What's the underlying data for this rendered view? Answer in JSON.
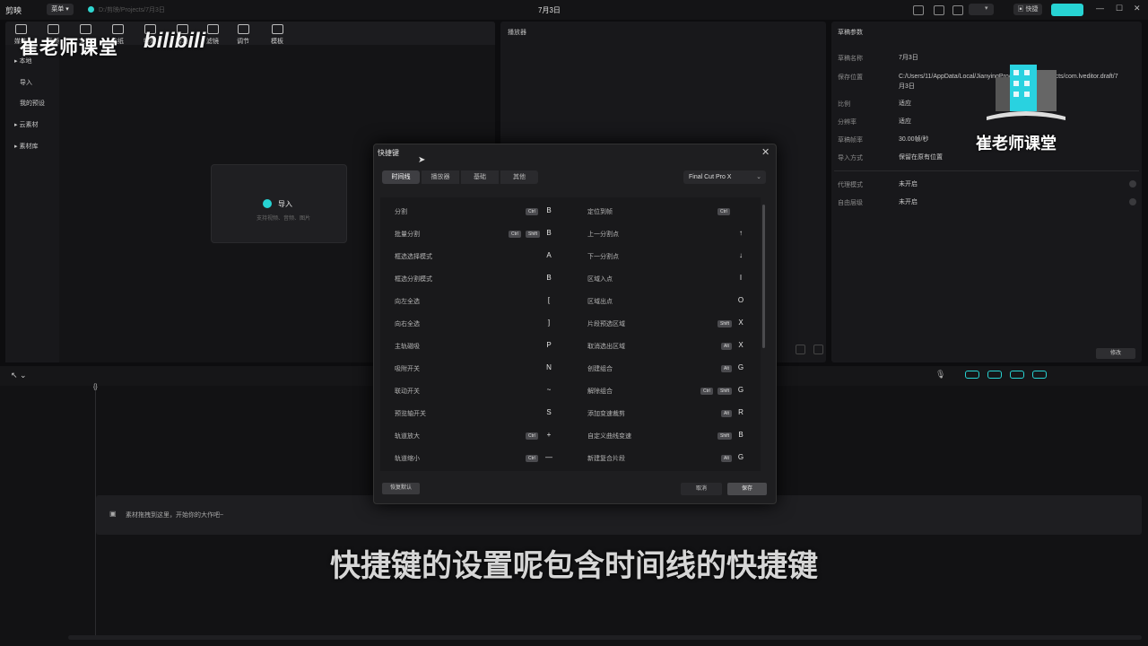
{
  "titlebar": {
    "app_name": "剪映",
    "menu_label": "菜单 ▾",
    "project_path": "D:/剪映/Projects/7月3日",
    "title": "7月3日",
    "pill_label": "▾",
    "pill2_label": "▣ 快捷",
    "window_controls": [
      "—",
      "☐",
      "✕"
    ]
  },
  "media": {
    "tools": [
      {
        "label": "媒体",
        "icon": "media-icon"
      },
      {
        "label": "音频",
        "icon": "audio-icon"
      },
      {
        "label": "文本",
        "icon": "text-icon"
      },
      {
        "label": "贴纸",
        "icon": "sticker-icon"
      },
      {
        "label": "特效",
        "icon": "effects-icon"
      },
      {
        "label": "转场",
        "icon": "transition-icon"
      },
      {
        "label": "滤镜",
        "icon": "filter-icon"
      },
      {
        "label": "调节",
        "icon": "adjust-icon"
      },
      {
        "label": "模板",
        "icon": "template-icon"
      }
    ],
    "sidebar": [
      "▸ 本地",
      "导入",
      "我的预设",
      "▸ 云素材",
      "▸ 素材库"
    ],
    "import_label": "导入",
    "import_sub": "支持视频、音频、图片"
  },
  "player": {
    "title": "播放器"
  },
  "draft": {
    "title": "草稿参数",
    "rows": [
      {
        "key": "草稿名称",
        "value": "7月3日"
      },
      {
        "key": "保存位置",
        "value": "C:/Users/11/AppData/Local/JianyingPro/User Data/Projects/com.lveditor.draft/7月3日"
      },
      {
        "key": "比例",
        "value": "适应"
      },
      {
        "key": "分辨率",
        "value": "适应"
      },
      {
        "key": "草稿帧率",
        "value": "30.00帧/秒"
      },
      {
        "key": "导入方式",
        "value": "保留在原有位置"
      },
      {
        "key": "代理模式",
        "value": "未开启"
      },
      {
        "key": "自由层级",
        "value": "未开启"
      }
    ],
    "button": "修改"
  },
  "timeline": {
    "drop_hint": "素材拖拽到这里，开始你的大作吧~",
    "playhead_label": "{}",
    "cursor_icon": "↖ ⌄",
    "mic_icon": "🎙"
  },
  "dialog": {
    "title": "快捷键",
    "close": "✕",
    "tabs": [
      "时间线",
      "播放器",
      "基础",
      "其他"
    ],
    "preset": "Final Cut Pro X",
    "preset_chevron": "⌄",
    "left": [
      {
        "label": "分割",
        "mods": [
          "Ctrl"
        ],
        "key": "B"
      },
      {
        "label": "批量分割",
        "mods": [
          "Ctrl",
          "Shift"
        ],
        "key": "B"
      },
      {
        "label": "框选选择模式",
        "mods": [],
        "key": "A"
      },
      {
        "label": "框选分割模式",
        "mods": [],
        "key": "B"
      },
      {
        "label": "向左全选",
        "mods": [],
        "key": "["
      },
      {
        "label": "向右全选",
        "mods": [],
        "key": "]"
      },
      {
        "label": "主轨磁吸",
        "mods": [],
        "key": "P"
      },
      {
        "label": "吸附开关",
        "mods": [],
        "key": "N"
      },
      {
        "label": "联动开关",
        "mods": [],
        "key": "~"
      },
      {
        "label": "预览轴开关",
        "mods": [],
        "key": "S"
      },
      {
        "label": "轨道放大",
        "mods": [
          "Ctrl"
        ],
        "key": "+"
      },
      {
        "label": "轨道缩小",
        "mods": [
          "Ctrl"
        ],
        "key": "—"
      }
    ],
    "right": [
      {
        "label": "定位到帧",
        "mods": [
          "Ctrl"
        ],
        "key": ""
      },
      {
        "label": "上一分割点",
        "mods": [],
        "key": "↑"
      },
      {
        "label": "下一分割点",
        "mods": [],
        "key": "↓"
      },
      {
        "label": "区域入点",
        "mods": [],
        "key": "I"
      },
      {
        "label": "区域出点",
        "mods": [],
        "key": "O"
      },
      {
        "label": "片段预选区域",
        "mods": [
          "Shift"
        ],
        "key": "X"
      },
      {
        "label": "取消选出区域",
        "mods": [
          "Alt"
        ],
        "key": "X"
      },
      {
        "label": "创建组合",
        "mods": [
          "Alt"
        ],
        "key": "G"
      },
      {
        "label": "解除组合",
        "mods": [
          "Ctrl",
          "Shift"
        ],
        "key": "G"
      },
      {
        "label": "添加变速裁剪",
        "mods": [
          "Alt"
        ],
        "key": "R"
      },
      {
        "label": "自定义曲线变速",
        "mods": [
          "Shift"
        ],
        "key": "B"
      },
      {
        "label": "新建复合片段",
        "mods": [
          "Alt"
        ],
        "key": "G"
      }
    ],
    "reset": "恢复默认",
    "cancel": "取消",
    "ok": "保存"
  },
  "watermark": {
    "left": "崔老师课堂",
    "bili": "bilibili",
    "right": "崔老师课堂"
  },
  "subtitle": "快捷键的设置呢包含时间线的快捷键",
  "colors": {
    "accent": "#27d3d3",
    "background": "#0d0d0f",
    "panel": "#18181b",
    "dialog": "#1e1e20"
  }
}
